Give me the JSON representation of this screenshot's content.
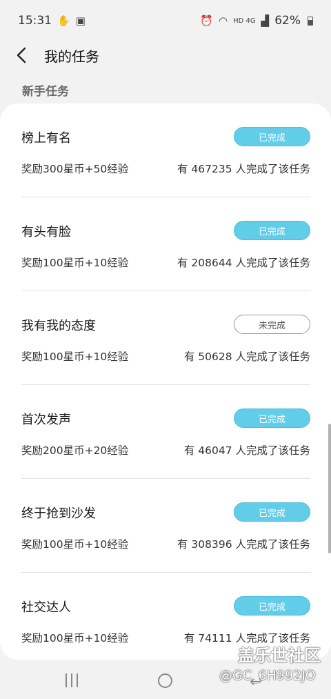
{
  "status_bar": {
    "time": "15:31",
    "network": "HD 4G",
    "battery": "62%"
  },
  "header": {
    "title": "我的任务"
  },
  "section": {
    "title": "新手任务"
  },
  "tasks": [
    {
      "name": "榜上有名",
      "reward": "奖励300星币+50经验",
      "count": "有 467235 人完成了该任务",
      "status": "已完成"
    },
    {
      "name": "有头有脸",
      "reward": "奖励100星币+10经验",
      "count": "有 208644 人完成了该任务",
      "status": "已完成"
    },
    {
      "name": "我有我的态度",
      "reward": "奖励100星币+10经验",
      "count": "有 50628 人完成了该任务",
      "status": "未完成"
    },
    {
      "name": "首次发声",
      "reward": "奖励200星币+20经验",
      "count": "有 46047 人完成了该任务",
      "status": "已完成"
    },
    {
      "name": "终于抢到沙发",
      "reward": "奖励100星币+10经验",
      "count": "有 308396 人完成了该任务",
      "status": "已完成"
    },
    {
      "name": "社交达人",
      "reward": "奖励100星币+10经验",
      "count": "有 74111 人完成了该任务",
      "status": "已完成"
    }
  ],
  "watermark": {
    "brand": "盖乐世社区",
    "user": "@GC_6H992JO"
  },
  "colors": {
    "done_button": "#62cde8",
    "background": "#f2f2f2"
  }
}
